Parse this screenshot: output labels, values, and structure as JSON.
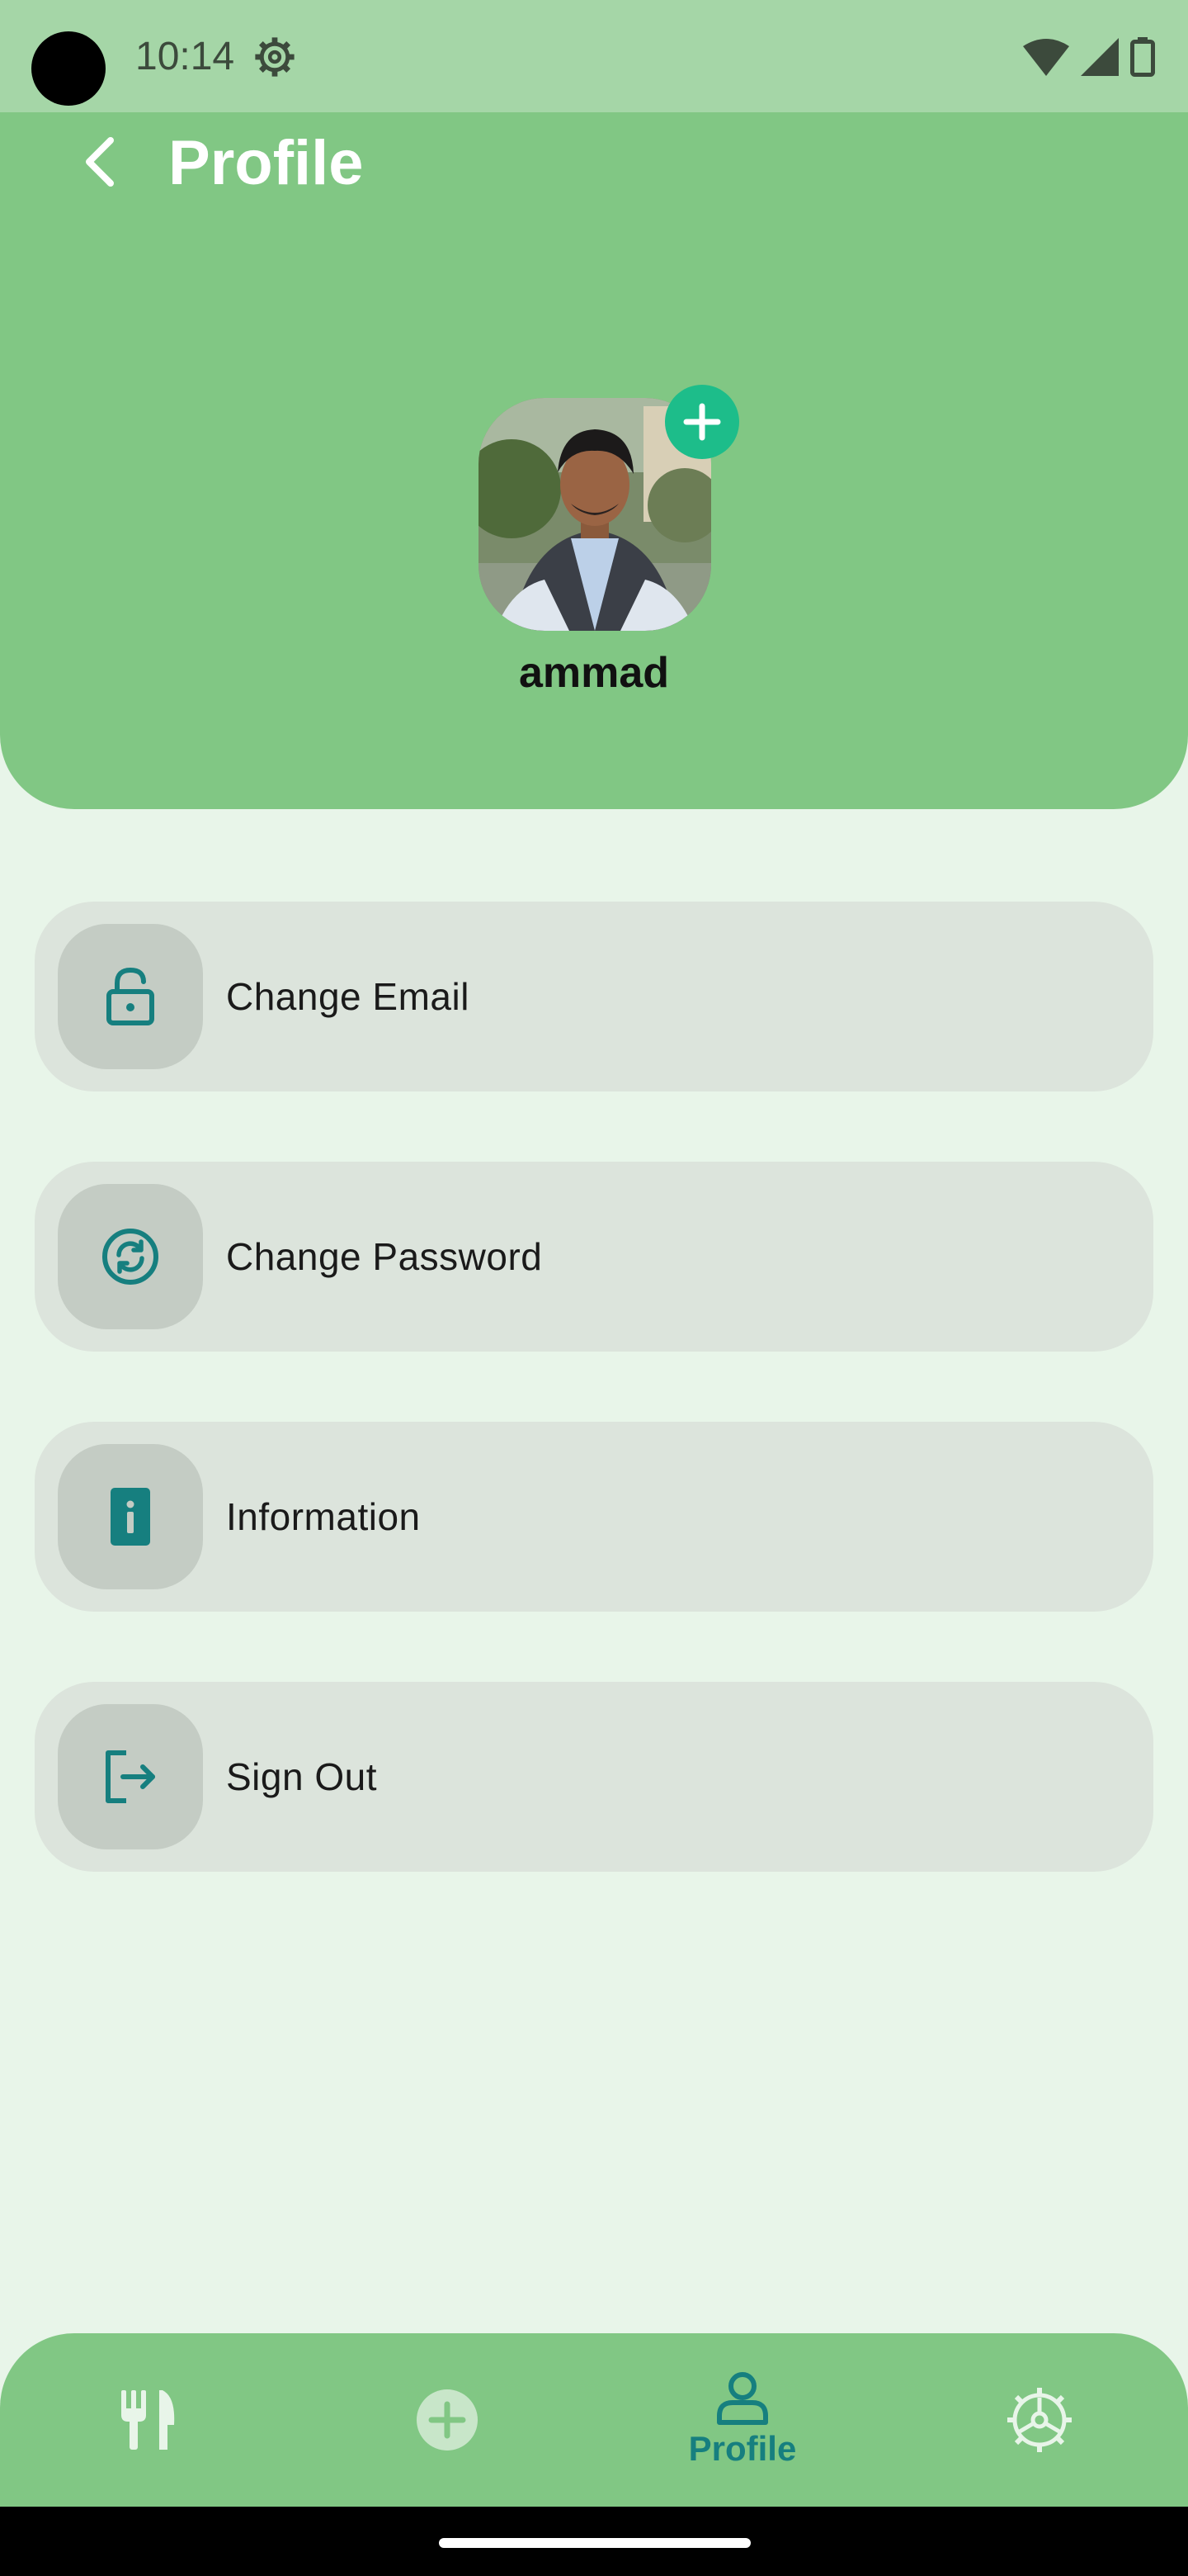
{
  "status_bar": {
    "time": "10:14"
  },
  "header": {
    "title": "Profile",
    "user_name": "ammad"
  },
  "menu": {
    "items": [
      {
        "label": "Change Email",
        "icon": "lock-open-icon"
      },
      {
        "label": "Change Password",
        "icon": "refresh-circle-icon"
      },
      {
        "label": "Information",
        "icon": "info-phone-icon"
      },
      {
        "label": "Sign Out",
        "icon": "logout-icon"
      }
    ]
  },
  "bottom_nav": {
    "items": [
      {
        "label": "",
        "icon": "fork-knife-icon",
        "active": false
      },
      {
        "label": "",
        "icon": "add-circle-icon",
        "active": false
      },
      {
        "label": "Profile",
        "icon": "person-icon",
        "active": true
      },
      {
        "label": "",
        "icon": "settings-icon",
        "active": false
      }
    ]
  },
  "colors": {
    "accent": "#167F7F",
    "header_bg": "#81C784",
    "status_bg": "#A5D6A7",
    "page_bg": "#E8F5E9",
    "menu_item_bg": "#DCE4DC",
    "add_button": "#1DBD8A"
  }
}
